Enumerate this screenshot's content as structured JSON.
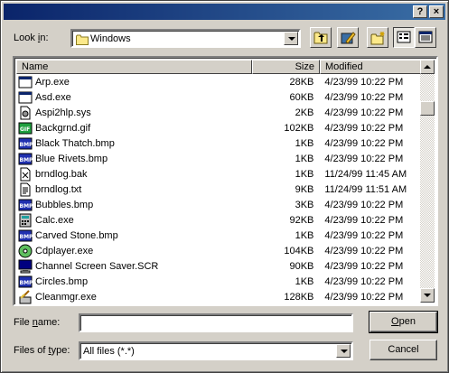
{
  "titlebar": {
    "help_label": "?",
    "close_label": "×"
  },
  "look_in": {
    "label_prefix": "Look ",
    "label_key": "i",
    "label_suffix": "n:",
    "value": "Windows"
  },
  "toolbar": {
    "icons": [
      "up-one-level-icon",
      "desktop-icon",
      "new-folder-icon",
      "list-view-icon",
      "details-view-icon"
    ]
  },
  "columns": {
    "name": "Name",
    "size": "Size",
    "modified": "Modified"
  },
  "files": [
    {
      "name": "Arp.exe",
      "size": "28KB",
      "modified": "4/23/99 10:22 PM",
      "icon": "exe-window-icon"
    },
    {
      "name": "Asd.exe",
      "size": "60KB",
      "modified": "4/23/99 10:22 PM",
      "icon": "exe-window-icon"
    },
    {
      "name": "Aspi2hlp.sys",
      "size": "2KB",
      "modified": "4/23/99 10:22 PM",
      "icon": "system-file-icon"
    },
    {
      "name": "Backgrnd.gif",
      "size": "102KB",
      "modified": "4/23/99 10:22 PM",
      "icon": "gif-image-icon"
    },
    {
      "name": "Black Thatch.bmp",
      "size": "1KB",
      "modified": "4/23/99 10:22 PM",
      "icon": "bmp-image-icon"
    },
    {
      "name": "Blue Rivets.bmp",
      "size": "1KB",
      "modified": "4/23/99 10:22 PM",
      "icon": "bmp-image-icon"
    },
    {
      "name": "brndlog.bak",
      "size": "1KB",
      "modified": "11/24/99 11:45 AM",
      "icon": "bak-file-icon"
    },
    {
      "name": "brndlog.txt",
      "size": "9KB",
      "modified": "11/24/99 11:51 AM",
      "icon": "text-file-icon"
    },
    {
      "name": "Bubbles.bmp",
      "size": "3KB",
      "modified": "4/23/99 10:22 PM",
      "icon": "bmp-image-icon"
    },
    {
      "name": "Calc.exe",
      "size": "92KB",
      "modified": "4/23/99 10:22 PM",
      "icon": "calculator-icon"
    },
    {
      "name": "Carved Stone.bmp",
      "size": "1KB",
      "modified": "4/23/99 10:22 PM",
      "icon": "bmp-image-icon"
    },
    {
      "name": "Cdplayer.exe",
      "size": "104KB",
      "modified": "4/23/99 10:22 PM",
      "icon": "cd-player-icon"
    },
    {
      "name": "Channel Screen Saver.SCR",
      "size": "90KB",
      "modified": "4/23/99 10:22 PM",
      "icon": "screensaver-icon"
    },
    {
      "name": "Circles.bmp",
      "size": "1KB",
      "modified": "4/23/99 10:22 PM",
      "icon": "bmp-image-icon"
    },
    {
      "name": "Cleanmgr.exe",
      "size": "128KB",
      "modified": "4/23/99 10:22 PM",
      "icon": "disk-cleanup-icon"
    }
  ],
  "file_name": {
    "label_prefix": "File ",
    "label_key": "n",
    "label_suffix": "ame:",
    "value": ""
  },
  "files_of_type": {
    "label_prefix": "Files of ",
    "label_key": "t",
    "label_suffix": "ype:",
    "value": "All files (*.*)"
  },
  "buttons": {
    "open_key": "O",
    "open_rest": "pen",
    "cancel": "Cancel"
  },
  "colors": {
    "dialog_bg": "#d4d0c8",
    "titlebar_start": "#0a246a",
    "titlebar_end": "#3a6ea5"
  }
}
